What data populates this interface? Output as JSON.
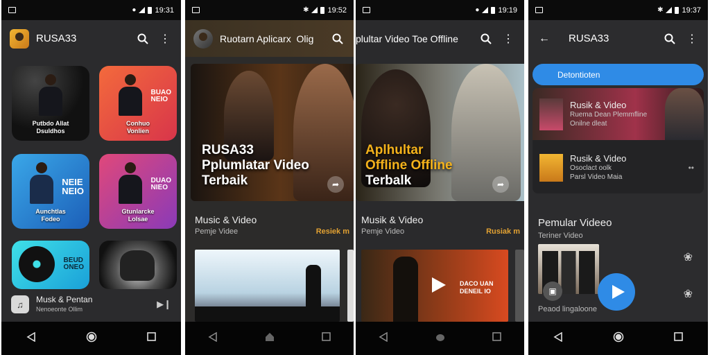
{
  "status": {
    "times": [
      "19:31",
      "19:52",
      "19:19",
      "19:37"
    ]
  },
  "screen1": {
    "app_title": "RUSA33",
    "tiles": [
      {
        "label_1": "Putbdo Allat",
        "label_2": "Dsuldhos",
        "side": ""
      },
      {
        "label_1": "Conhuo",
        "label_2": "Vonlien",
        "side": "BUAO\nNEIO"
      },
      {
        "label_1": "Aunchtlas",
        "label_2": "Fodeo",
        "side": "NEIE\nNEIO"
      },
      {
        "label_1": "Gtunlarcke",
        "label_2": "Lolsae",
        "side": "DUAO\nNIEO"
      },
      {
        "label_1": "",
        "label_2": "",
        "side": "BEUD\nONEO"
      },
      {
        "label_1": "",
        "label_2": "",
        "side": ""
      }
    ],
    "mini_player": {
      "title": "Musk & Pentan",
      "subtitle": "Nenoeonte Ollim"
    }
  },
  "screen2": {
    "app_title": "Ruotarn Aplicarx",
    "app_title_extra": "Olig",
    "hero": {
      "line1": "RUSA33",
      "line2": "Pplumlatar Video",
      "line3": "Terbaik"
    },
    "section_title": "Music & Video",
    "section_subtitle": "Pemje Videe",
    "see_all": "Resiek m"
  },
  "screen3": {
    "app_title": "plultar Video Toe Offline",
    "hero": {
      "line1": "Aplhultar",
      "line2": "Offline Offline",
      "line3": "Terbalk"
    },
    "section_title": "Musik & Video",
    "section_subtitle": "Pemje Video",
    "see_all": "Rusiak m",
    "thumb_text": "DACO UAN\nDENEIL IO"
  },
  "screen4": {
    "app_title": "RUSA33",
    "pill_label": "Detontioten",
    "rows": [
      {
        "title": "Rusik & Video",
        "line2": "Ruema Dean Plemmfline",
        "line3": "Onilne dleat"
      },
      {
        "title": "Rusik & Video",
        "line2": "Osoclact oolk",
        "line3": "Parsl Video Maia"
      }
    ],
    "section_title": "Pemular Videeo",
    "section_subtitle": "Teriner Video",
    "caption": "Peaod lingaloone"
  }
}
